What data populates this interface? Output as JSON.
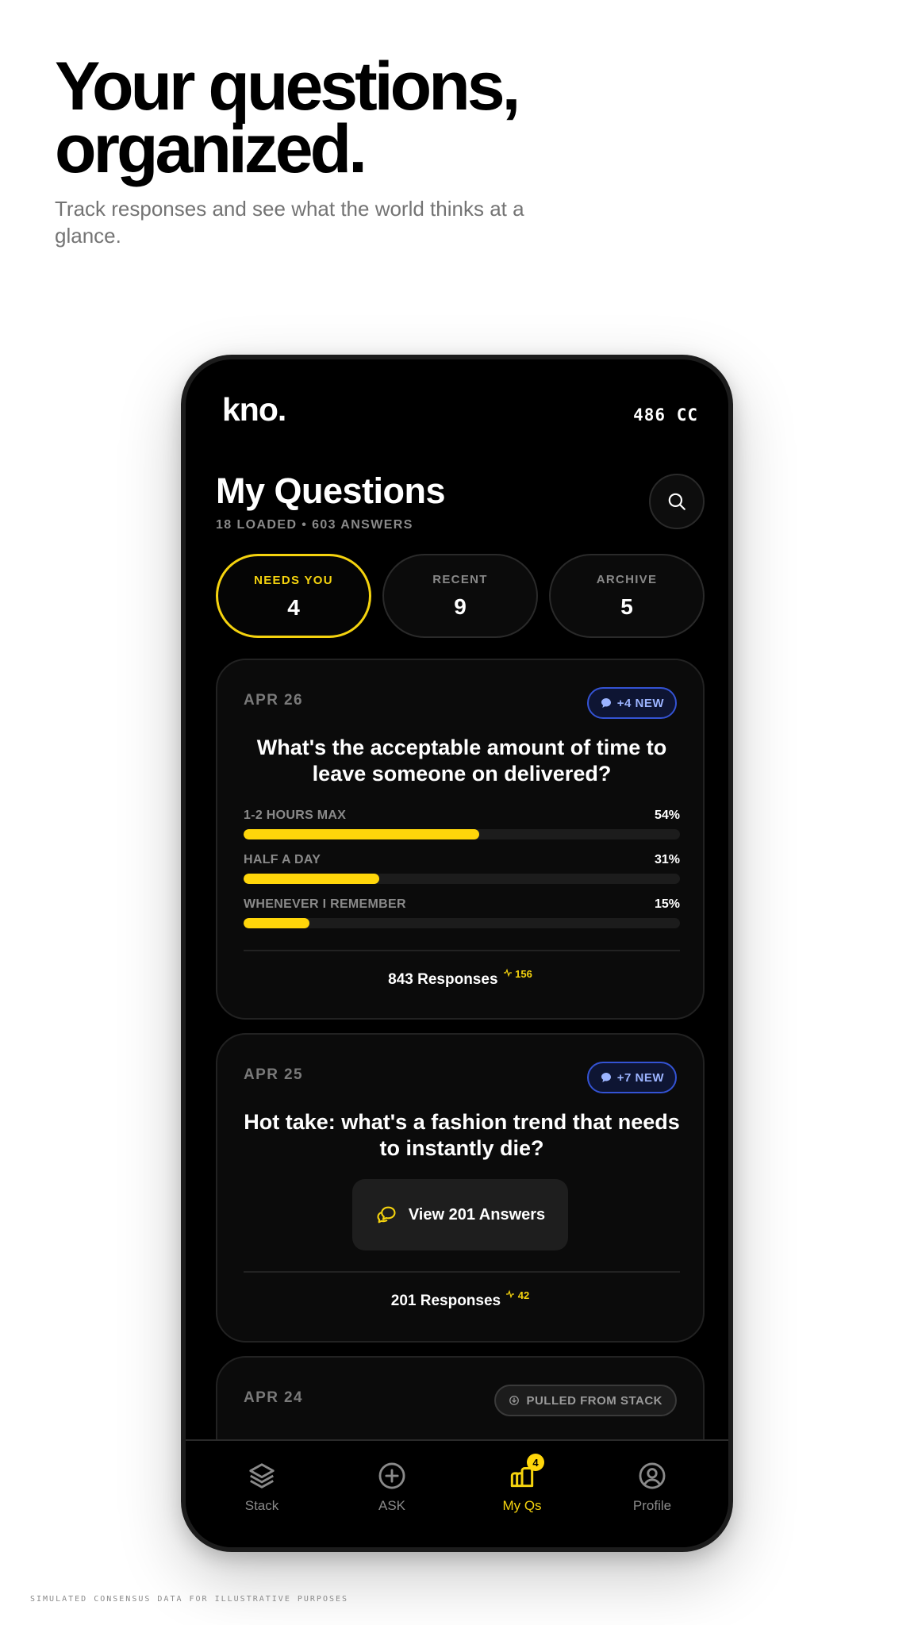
{
  "hero": {
    "title_line1": "Your questions,",
    "title_line2": "organized.",
    "subtitle": "Track responses and see what the world thinks at a glance."
  },
  "app": {
    "logo": "kno.",
    "credits": "486 CC",
    "title": "My Questions",
    "meta": "18 LOADED • 603 ANSWERS",
    "search_icon": "search-icon"
  },
  "tabs": [
    {
      "label": "NEEDS YOU",
      "count": "4",
      "active": true
    },
    {
      "label": "RECENT",
      "count": "9",
      "active": false
    },
    {
      "label": "ARCHIVE",
      "count": "5",
      "active": false
    }
  ],
  "cards": [
    {
      "date": "APR 26",
      "badge": "+4 NEW",
      "question": "What's the acceptable amount of time to leave someone on delivered?",
      "options": [
        {
          "label": "1-2 HOURS MAX",
          "pct": "54%",
          "value": 54
        },
        {
          "label": "HALF A DAY",
          "pct": "31%",
          "value": 31
        },
        {
          "label": "WHENEVER I REMEMBER",
          "pct": "15%",
          "value": 15
        }
      ],
      "responses": "843 Responses",
      "trend": "156"
    },
    {
      "date": "APR 25",
      "badge": "+7 NEW",
      "question": "Hot take: what's a fashion trend that needs to instantly die?",
      "view_label": "View 201 Answers",
      "responses": "201 Responses",
      "trend": "42"
    },
    {
      "date": "APR 24",
      "badge": "PULLED FROM STACK"
    }
  ],
  "nav": [
    {
      "label": "Stack",
      "icon": "stack-icon"
    },
    {
      "label": "ASK",
      "icon": "plus-circle-icon"
    },
    {
      "label": "My Qs",
      "icon": "my-questions-icon",
      "badge": "4",
      "active": true
    },
    {
      "label": "Profile",
      "icon": "profile-icon"
    }
  ],
  "footnote": "SIMULATED CONSENSUS DATA FOR ILLUSTRATIVE PURPOSES",
  "colors": {
    "accent": "#ffd60a",
    "badge_blue": "#3453d4",
    "background": "#000000"
  }
}
